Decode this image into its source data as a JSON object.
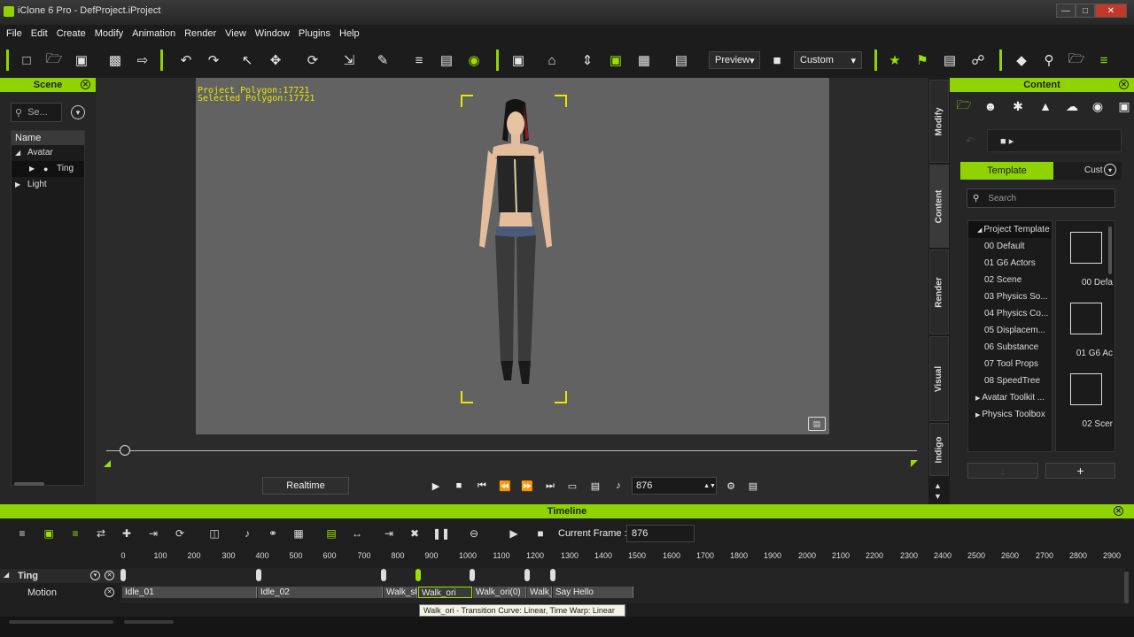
{
  "window": {
    "title": "iClone 6 Pro - DefProject.iProject"
  },
  "menu": [
    "File",
    "Edit",
    "Create",
    "Modify",
    "Animation",
    "Render",
    "View",
    "Window",
    "Plugins",
    "Help"
  ],
  "toolbar": {
    "preview_label": "Preview",
    "mode_label": "Custom"
  },
  "scene_panel": {
    "title": "Scene",
    "search_placeholder": "Se...",
    "column": "Name",
    "items": [
      "Avatar",
      "Ting",
      "Light"
    ]
  },
  "viewport": {
    "project_polygon": "Project Polygon:17721",
    "selected_polygon": "Selected Polygon:17721"
  },
  "playback": {
    "realtime_label": "Realtime",
    "frame": "876"
  },
  "side_tabs": [
    "Modify",
    "Content",
    "Render",
    "Visual",
    "Indigo"
  ],
  "content_panel": {
    "title": "Content",
    "tab_template": "Template",
    "tab_custom": "Cust",
    "search_placeholder": "Search",
    "tree_root": "Project Template",
    "tree_items": [
      "00 Default",
      "01 G6 Actors",
      "02 Scene",
      "03 Physics So...",
      "04 Physics Co...",
      "05 Displacem...",
      "06 Substance",
      "07 Tool Props",
      "08 SpeedTree",
      "Avatar Toolkit ...",
      "Physics Toolbox"
    ],
    "thumbs": [
      "00 Defa",
      "01 G6 Ac",
      "02 Scer"
    ],
    "add_label": "+"
  },
  "timeline": {
    "title": "Timeline",
    "current_frame_label": "Current Frame :",
    "current_frame": "876",
    "ruler": [
      "0",
      "100",
      "200",
      "300",
      "400",
      "500",
      "600",
      "700",
      "800",
      "900",
      "1000",
      "1100",
      "1200",
      "1300",
      "1400",
      "1500",
      "1600",
      "1700",
      "1800",
      "1900",
      "2000",
      "2100",
      "2200",
      "2300",
      "2400",
      "2500",
      "2600",
      "2700",
      "2800",
      "2900"
    ],
    "track_name": "Ting",
    "sub_track": "Motion",
    "clips": [
      "Idle_01",
      "Idle_02",
      "Walk_st",
      "Walk_ori",
      "Walk_ori(0)",
      "Walk_",
      "Say Hello"
    ],
    "tooltip": "Walk_ori - Transition Curve: Linear, Time Warp: Linear"
  }
}
